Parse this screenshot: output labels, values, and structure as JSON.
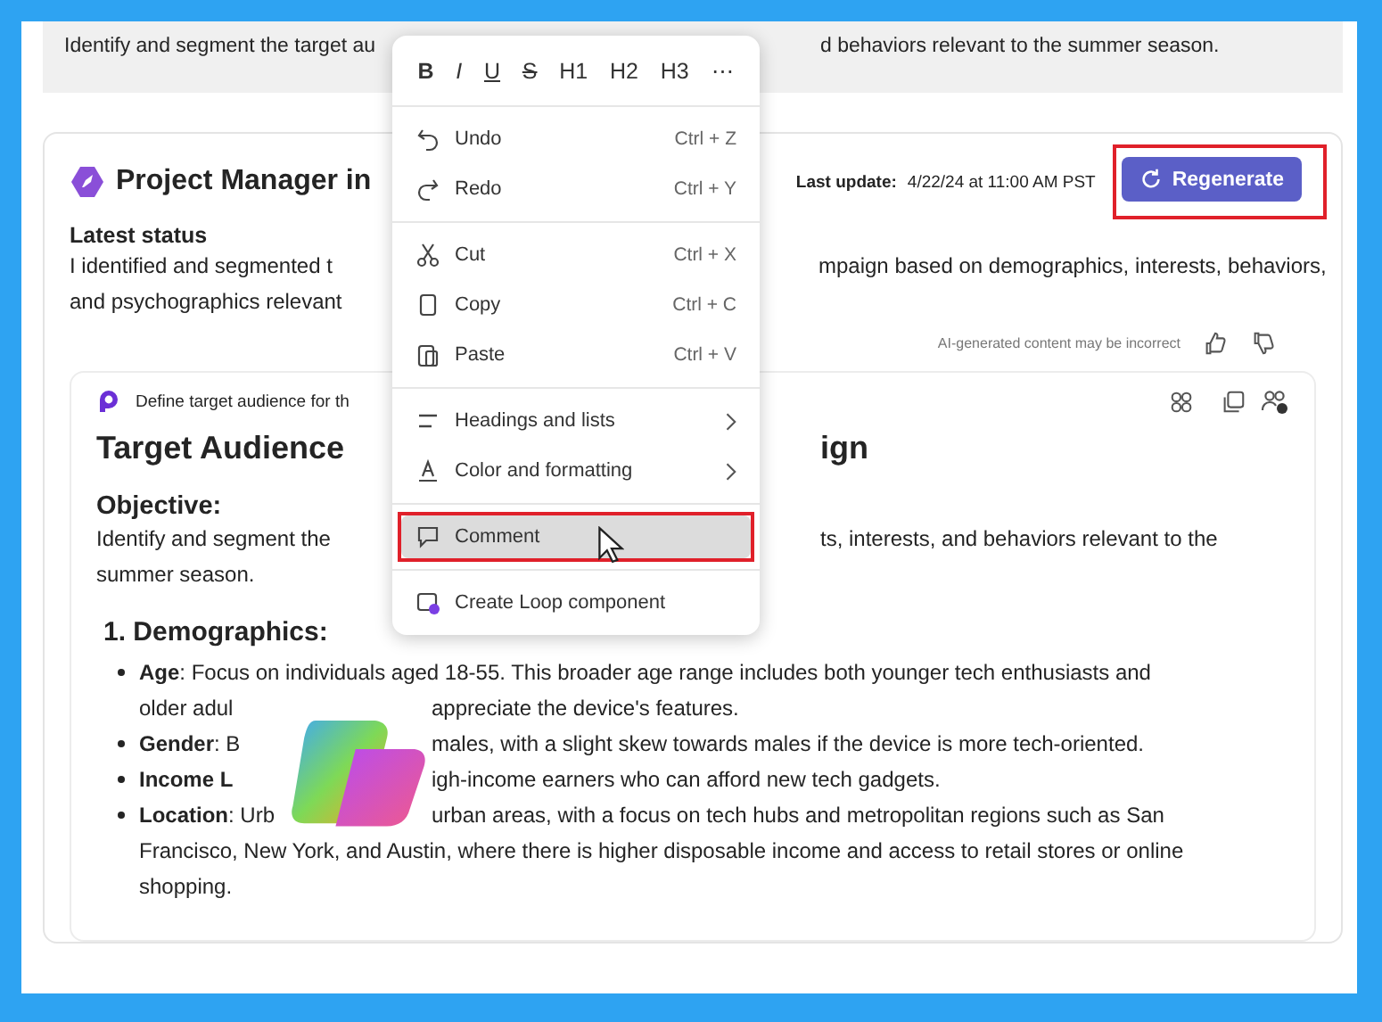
{
  "top_note": {
    "lines": [
      [
        "Identify and segment the target au",
        "d behaviors relevant to the summer season."
      ]
    ]
  },
  "status_card": {
    "title": "Project Manager in",
    "last_update_label": "Last update:",
    "last_update_value": "4/22/24 at 11:00 AM PST",
    "regenerate": {
      "label": "Regenerate",
      "annotated": true
    },
    "status_heading": "Latest status",
    "status_lines": [
      [
        "I identified and segmented t",
        "mpaign based on demographics, interests, behaviors,"
      ],
      [
        "and psychographics relevant"
      ]
    ],
    "disclaimer": "AI-generated content may be incorrect"
  },
  "loop_card": {
    "source": "Define target audience for th",
    "heading": [
      "Target Audience",
      "ign"
    ],
    "objective_label": "Objective:",
    "objective_lines": [
      [
        "Identify and segment the",
        "ts, interests, and behaviors relevant to the"
      ],
      [
        "summer season."
      ]
    ],
    "section_heading": "1. Demographics:",
    "bullets": [
      {
        "lines": [
          [
            "**Age**: Focus on individuals aged 18-55. This broader age range includes both younger tech enthusiasts and"
          ],
          [
            "older adul",
            "appreciate the device's features."
          ]
        ]
      },
      {
        "lines": [
          [
            "**Gender**: B",
            "males, with a slight skew towards males if the device is more tech-oriented."
          ]
        ]
      },
      {
        "lines": [
          [
            "**Income L**",
            "igh-income earners who can afford new tech gadgets."
          ]
        ]
      },
      {
        "lines": [
          [
            "**Location**: Urb",
            "urban areas, with a focus on tech hubs and metropolitan regions such as San"
          ],
          [
            "Francisco, New York, and Austin, where there is higher disposable income and access to retail stores or online"
          ],
          [
            "shopping."
          ]
        ]
      }
    ]
  },
  "context_menu": {
    "format_buttons": [
      {
        "label": "B",
        "kind": "bold"
      },
      {
        "label": "I",
        "kind": "italic"
      },
      {
        "label": "U",
        "kind": "underline"
      },
      {
        "label": "S",
        "kind": "strike"
      },
      {
        "label": "H1",
        "kind": "plain"
      },
      {
        "label": "H2",
        "kind": "plain"
      },
      {
        "label": "H3",
        "kind": "plain"
      },
      {
        "label": "⋯",
        "kind": "plain"
      }
    ],
    "sections": [
      [
        {
          "kind": "undo",
          "label": "Undo",
          "shortcut": "Ctrl + Z",
          "submenu": false,
          "selected": false,
          "annotated": false
        },
        {
          "kind": "redo",
          "label": "Redo",
          "shortcut": "Ctrl + Y",
          "submenu": false,
          "selected": false,
          "annotated": false
        }
      ],
      [
        {
          "kind": "cut",
          "label": "Cut",
          "shortcut": "Ctrl + X",
          "submenu": false,
          "selected": false,
          "annotated": false
        },
        {
          "kind": "copy",
          "label": "Copy",
          "shortcut": "Ctrl + C",
          "submenu": false,
          "selected": false,
          "annotated": false
        },
        {
          "kind": "paste",
          "label": "Paste",
          "shortcut": "Ctrl + V",
          "submenu": false,
          "selected": false,
          "annotated": false
        }
      ],
      [
        {
          "kind": "headings",
          "label": "Headings and lists",
          "submenu": true,
          "selected": false,
          "annotated": false
        },
        {
          "kind": "color",
          "label": "Color and formatting",
          "submenu": true,
          "selected": false,
          "annotated": false
        }
      ],
      [
        {
          "kind": "comment",
          "label": "Comment",
          "submenu": false,
          "selected": true,
          "annotated": true
        }
      ],
      [
        {
          "kind": "loop",
          "label": "Create Loop component",
          "submenu": false,
          "selected": false,
          "annotated": false
        }
      ]
    ]
  }
}
